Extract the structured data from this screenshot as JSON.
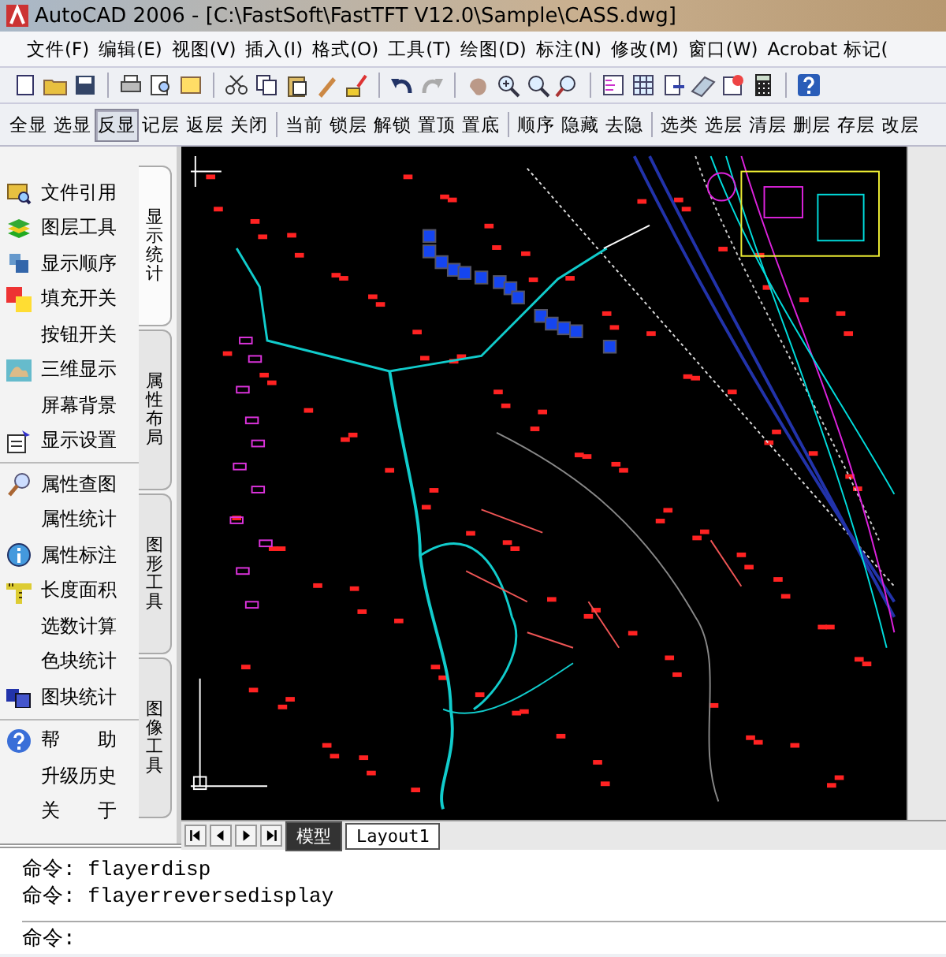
{
  "window": {
    "title": "AutoCAD 2006 - [C:\\FastSoft\\FastTFT V12.0\\Sample\\CASS.dwg]"
  },
  "menu": [
    "文件(F)",
    "编辑(E)",
    "视图(V)",
    "插入(I)",
    "格式(O)",
    "工具(T)",
    "绘图(D)",
    "标注(N)",
    "修改(M)",
    "窗口(W)",
    "Acrobat 标记("
  ],
  "layer_toolbar": [
    [
      {
        "label": "全显",
        "selected": false
      },
      {
        "label": "选显",
        "selected": false
      },
      {
        "label": "反显",
        "selected": true
      },
      {
        "label": "记层",
        "selected": false
      },
      {
        "label": "返层",
        "selected": false
      },
      {
        "label": "关闭",
        "selected": false
      }
    ],
    [
      {
        "label": "当前",
        "selected": false
      },
      {
        "label": "锁层",
        "selected": false
      },
      {
        "label": "解锁",
        "selected": false
      },
      {
        "label": "置顶",
        "selected": false
      },
      {
        "label": "置底",
        "selected": false
      }
    ],
    [
      {
        "label": "顺序",
        "selected": false
      },
      {
        "label": "隐藏",
        "selected": false
      },
      {
        "label": "去隐",
        "selected": false
      }
    ],
    [
      {
        "label": "选类",
        "selected": false
      },
      {
        "label": "选层",
        "selected": false
      },
      {
        "label": "清层",
        "selected": false
      },
      {
        "label": "删层",
        "selected": false
      },
      {
        "label": "存层",
        "selected": false
      },
      {
        "label": "改层",
        "selected": false
      }
    ]
  ],
  "sidebar": {
    "sections": [
      [
        {
          "label": "文件引用",
          "kind": "folder"
        },
        {
          "label": "图层工具",
          "kind": "layers"
        },
        {
          "label": "显示顺序",
          "kind": "order"
        },
        {
          "label": "填充开关",
          "kind": "fill"
        },
        {
          "label": "按钮开关",
          "kind": "none"
        },
        {
          "label": "三维显示",
          "kind": "terrain"
        },
        {
          "label": "屏幕背景",
          "kind": "none"
        },
        {
          "label": "显示设置",
          "kind": "settings"
        }
      ],
      [
        {
          "label": "属性查图",
          "kind": "search"
        },
        {
          "label": "属性统计",
          "kind": "none"
        },
        {
          "label": "属性标注",
          "kind": "info"
        },
        {
          "label": "长度面积",
          "kind": "ruler"
        },
        {
          "label": "选数计算",
          "kind": "none"
        },
        {
          "label": "色块统计",
          "kind": "none"
        },
        {
          "label": "图块统计",
          "kind": "blocks"
        }
      ],
      [
        {
          "label": "帮 助",
          "kind": "help"
        },
        {
          "label": "升级历史",
          "kind": "none"
        },
        {
          "label": "关 于",
          "kind": "none"
        }
      ]
    ],
    "tabs": [
      {
        "label": "显示统计",
        "selected": true
      },
      {
        "label": "属性布局",
        "selected": false
      },
      {
        "label": "图形工具",
        "selected": false
      },
      {
        "label": "图像工具",
        "selected": false
      }
    ]
  },
  "layout_tabs": [
    {
      "label": "模型",
      "selected": true
    },
    {
      "label": "Layout1",
      "selected": false
    }
  ],
  "command": {
    "history": [
      "命令: flayerdisp",
      "命令: flayerreversedisplay"
    ],
    "prompt": "命令:"
  }
}
